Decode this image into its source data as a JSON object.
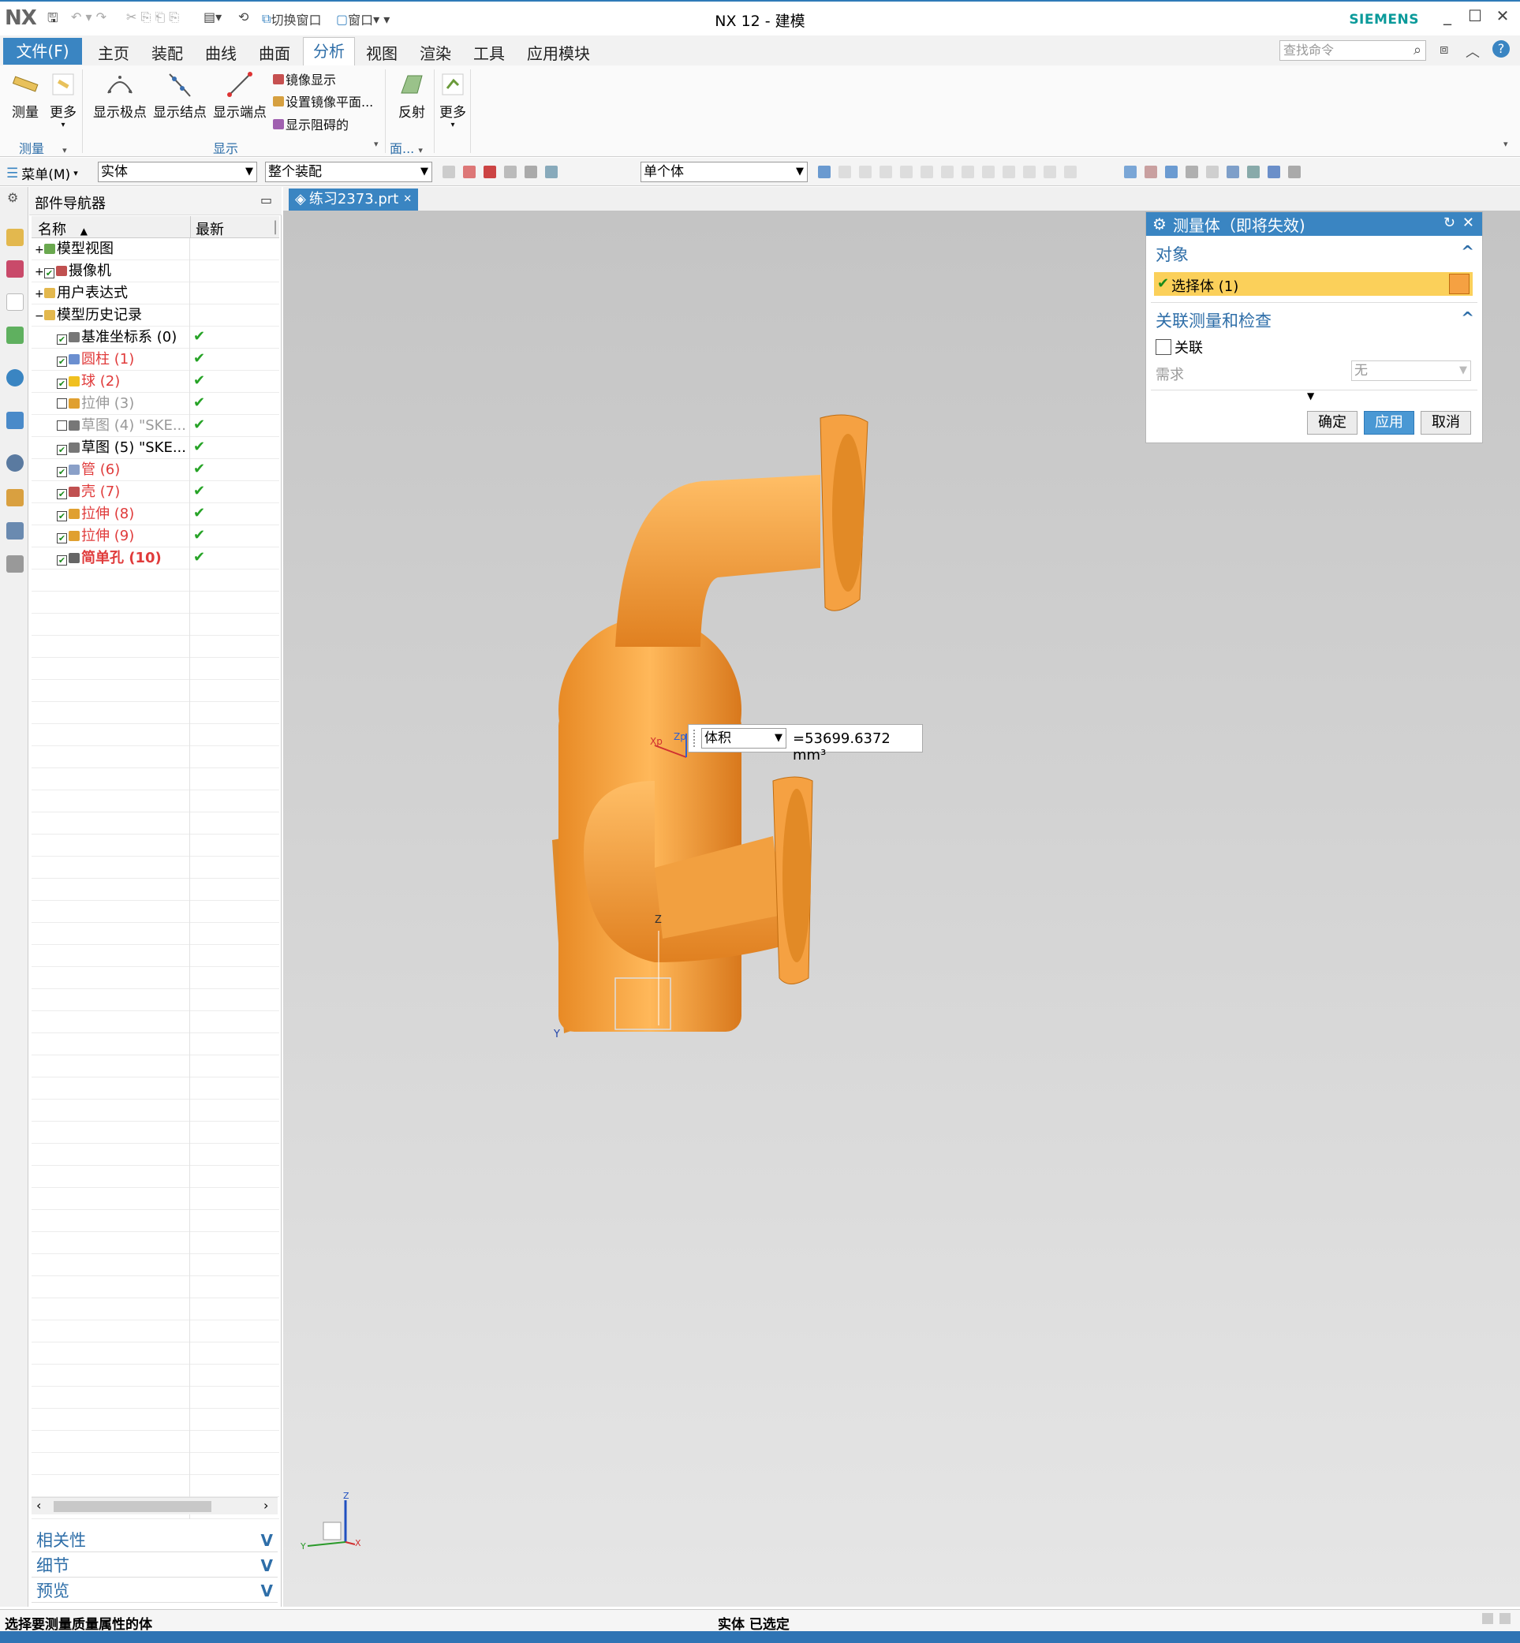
{
  "app": {
    "logo": "NX",
    "window_title": "NX 12 - 建模",
    "brand": "SIEMENS",
    "quick_access": {
      "switch_window": "切换窗口",
      "window": "窗口"
    }
  },
  "menu_tabs": {
    "file": "文件(F)",
    "items": [
      "主页",
      "装配",
      "曲线",
      "曲面",
      "分析",
      "视图",
      "渲染",
      "工具",
      "应用模块"
    ],
    "active": "分析",
    "search_placeholder": "查找命令"
  },
  "ribbon": {
    "measure": "测量",
    "more": "更多",
    "show_poles": "显示极点",
    "show_knots": "显示结点",
    "show_endpoints": "显示端点",
    "mirror_display": "镜像显示",
    "set_mirror_plane": "设置镜像平面...",
    "show_obstructions": "显示阻碍的",
    "reflection": "反射",
    "more2": "更多",
    "group_measure": "测量",
    "group_display": "显示",
    "group_face": "面..."
  },
  "toolbar2": {
    "menu": "菜单(M)",
    "type_filter": "实体",
    "scope": "整个装配",
    "body_rule": "单个体"
  },
  "navigator": {
    "title": "部件导航器",
    "col_name": "名称",
    "col_latest": "最新",
    "rows": [
      {
        "label": "模型视图",
        "style": "normal"
      },
      {
        "label": "摄像机",
        "style": "normal"
      },
      {
        "label": "用户表达式",
        "style": "normal"
      },
      {
        "label": "模型历史记录",
        "style": "normal"
      },
      {
        "label": "基准坐标系 (0)",
        "style": "normal"
      },
      {
        "label": "圆柱 (1)",
        "style": "red"
      },
      {
        "label": "球 (2)",
        "style": "red"
      },
      {
        "label": "拉伸 (3)",
        "style": "gray"
      },
      {
        "label": "草图 (4) \"SKE...",
        "style": "gray"
      },
      {
        "label": "草图 (5) \"SKE...",
        "style": "normal"
      },
      {
        "label": "管 (6)",
        "style": "red"
      },
      {
        "label": "壳 (7)",
        "style": "red"
      },
      {
        "label": "拉伸 (8)",
        "style": "red"
      },
      {
        "label": "拉伸 (9)",
        "style": "red"
      },
      {
        "label": "简单孔 (10)",
        "style": "redbold"
      }
    ],
    "panels": [
      "相关性",
      "细节",
      "预览"
    ]
  },
  "document": {
    "tab": "练习2373.prt"
  },
  "dialog": {
    "title": "测量体（即将失效)",
    "sec_object": "对象",
    "select_body": "选择体 (1)",
    "sec_assoc": "关联测量和检查",
    "assoc_label": "关联",
    "require_label": "需求",
    "require_value": "无",
    "ok": "确定",
    "apply": "应用",
    "cancel": "取消"
  },
  "measurement": {
    "quantity": "体积",
    "value": "=53699.6372 mm³"
  },
  "triad": {
    "z": "Z",
    "y": "Y",
    "x": "X",
    "xp": "Xp",
    "zp": "Zp"
  },
  "status": {
    "left": "选择要测量质量属性的体",
    "center": "实体 已选定"
  },
  "colors": {
    "accent": "#3a85c2",
    "part": "#f5a142",
    "highlight": "#fbd05a",
    "check": "#26a326"
  }
}
